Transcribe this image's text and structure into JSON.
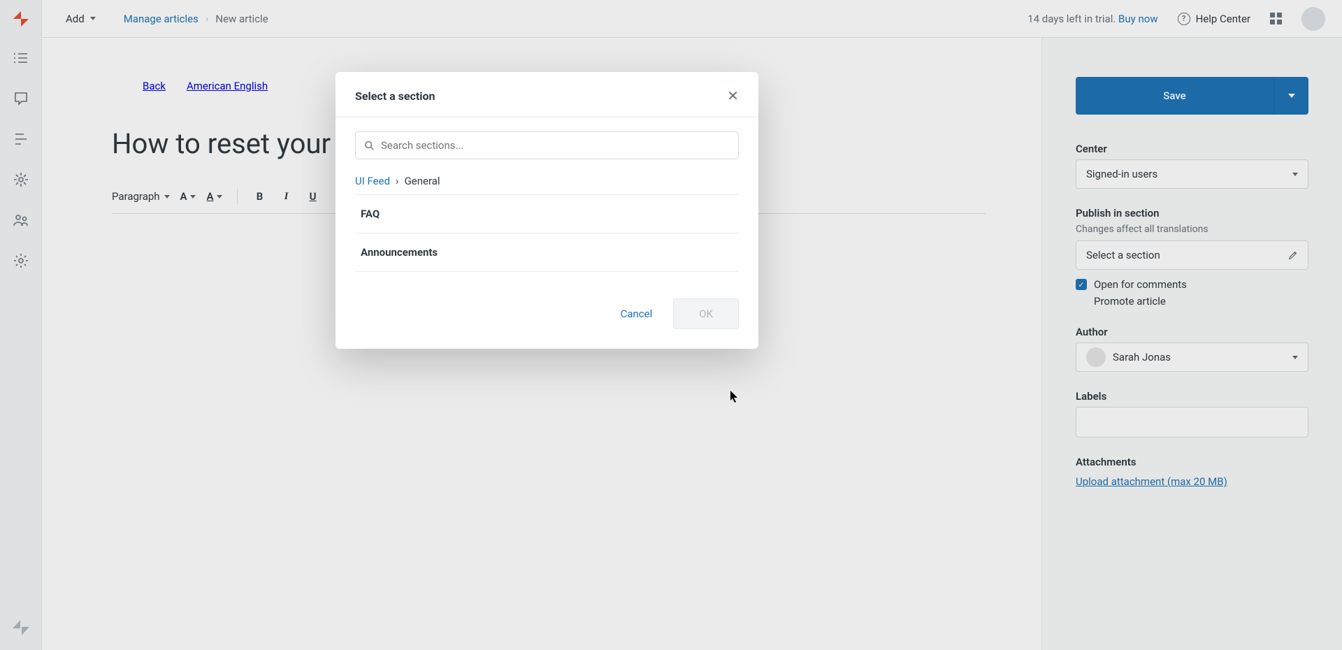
{
  "topbar": {
    "add_label": "Add",
    "breadcrumb_manage": "Manage articles",
    "breadcrumb_current": "New article",
    "trial_text": "14 days left in trial.",
    "buy_now": "Buy now",
    "help_center": "Help Center"
  },
  "article": {
    "back_label": "Back",
    "language": "American English",
    "title_value": "How to reset your p",
    "toolbar_paragraph": "Paragraph"
  },
  "right_panel": {
    "save_label": "Save",
    "center_label": "Center",
    "center_value": "Signed-in users",
    "publish_label": "Publish in section",
    "publish_hint": "Changes affect all translations",
    "publish_placeholder": "Select a section",
    "open_comments": "Open for comments",
    "promote_article": "Promote article",
    "author_label": "Author",
    "author_name": "Sarah Jonas",
    "labels_label": "Labels",
    "attachments_label": "Attachments",
    "attachments_link": "Upload attachment (max 20 MB)"
  },
  "modal": {
    "title": "Select a section",
    "search_placeholder": "Search sections...",
    "breadcrumb_root": "UI Feed",
    "breadcrumb_current": "General",
    "sections": {
      "faq": "FAQ",
      "announcements": "Announcements"
    },
    "cancel_label": "Cancel",
    "ok_label": "OK"
  }
}
